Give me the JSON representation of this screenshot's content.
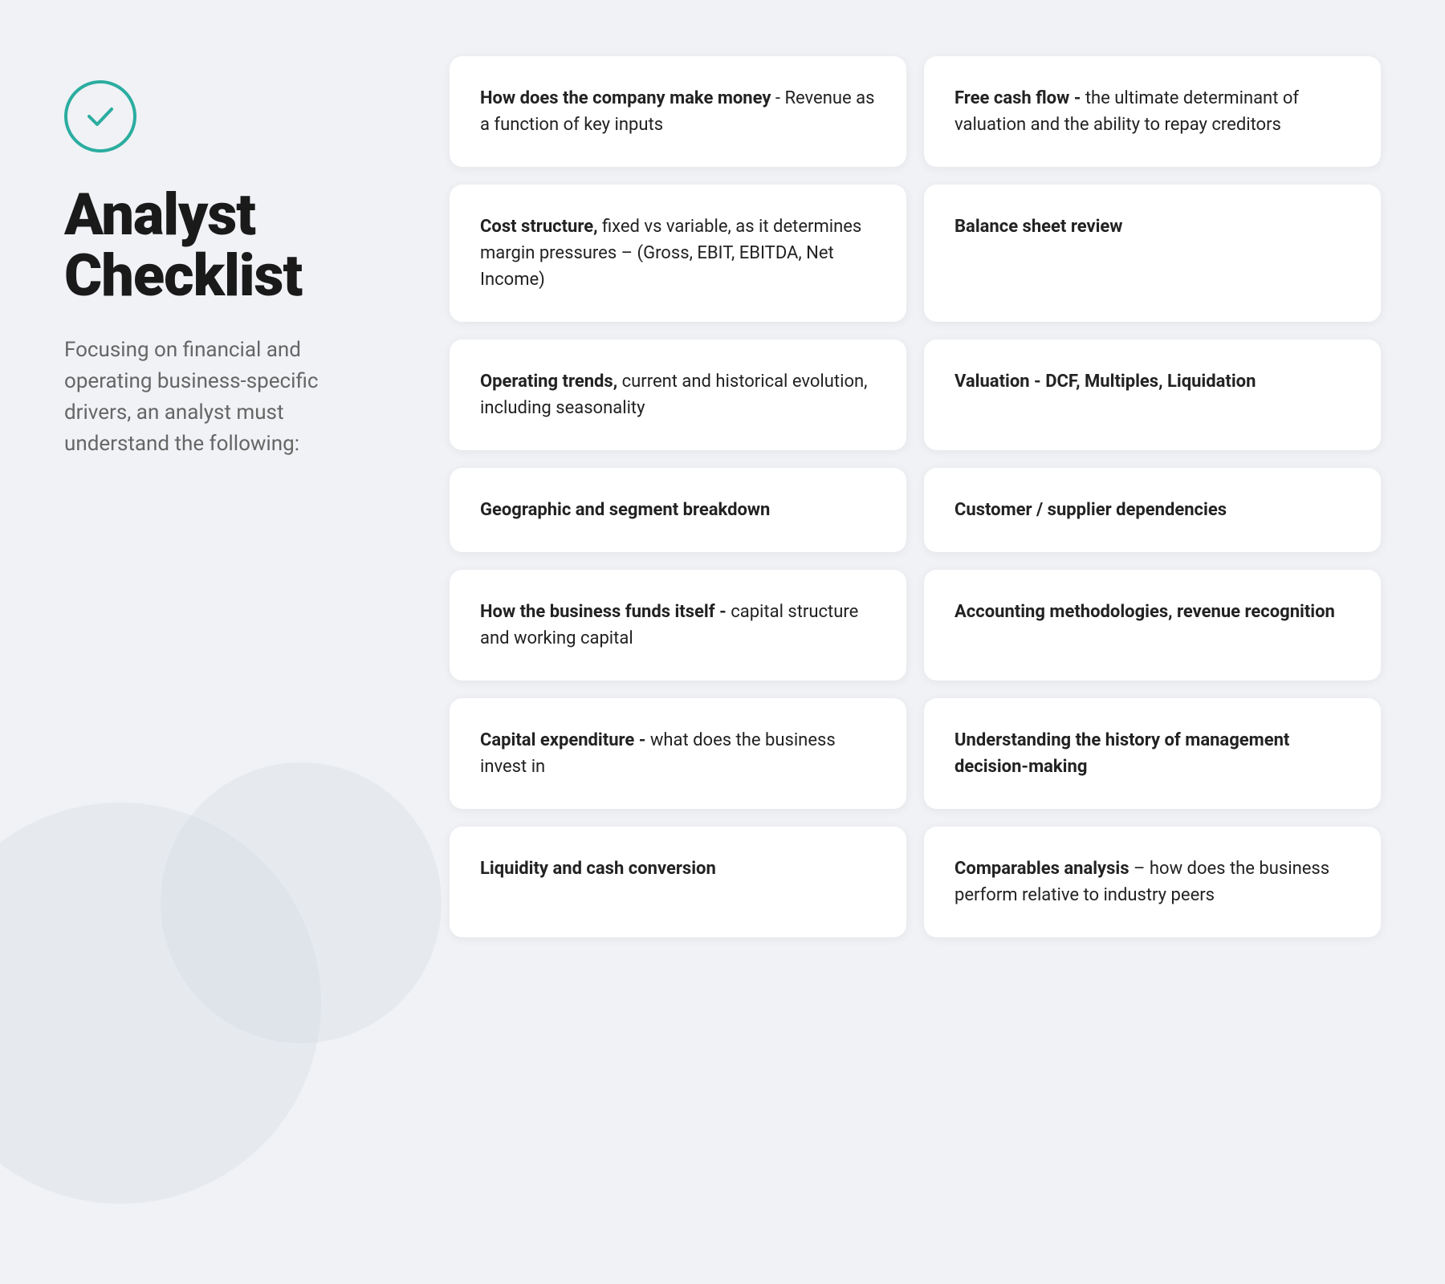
{
  "page": {
    "background_color": "#f0f2f5"
  },
  "left": {
    "check_icon_label": "checkmark",
    "title": "Analyst Checklist",
    "subtitle": "Focusing on financial and operating business-specific drivers, an analyst must understand the following:"
  },
  "cards": [
    {
      "id": "card-revenue",
      "html": "<strong>How does the company make money</strong> - Revenue as a function of key inputs"
    },
    {
      "id": "card-free-cash-flow",
      "html": "<strong>Free cash flow -</strong> the ultimate determinant of valuation and the ability to repay creditors"
    },
    {
      "id": "card-cost-structure",
      "html": "<strong>Cost structure,</strong> fixed vs variable, as it determines margin pressures – (Gross, EBIT, EBITDA, Net Income)"
    },
    {
      "id": "card-balance-sheet",
      "html": "<strong>Balance sheet review</strong>"
    },
    {
      "id": "card-operating-trends",
      "html": "<strong>Operating trends,</strong> current and historical evolution, including seasonality"
    },
    {
      "id": "card-valuation",
      "html": "<strong>Valuation - DCF, Multiples, Liquidation</strong>"
    },
    {
      "id": "card-geographic",
      "html": "<strong>Geographic and segment breakdown</strong>"
    },
    {
      "id": "card-customer-supplier",
      "html": "<strong>Customer / supplier dependencies</strong>"
    },
    {
      "id": "card-funds-itself",
      "html": "<strong>How the business funds itself -</strong> capital structure and working capital"
    },
    {
      "id": "card-accounting",
      "html": "<strong>Accounting methodologies, revenue recognition</strong>"
    },
    {
      "id": "card-capex",
      "html": "<strong>Capital expenditure -</strong> what does the business invest in"
    },
    {
      "id": "card-management",
      "html": "<strong>Understanding the history of management decision-making</strong>"
    },
    {
      "id": "card-liquidity",
      "html": "<strong>Liquidity and cash conversion</strong>"
    },
    {
      "id": "card-comparables",
      "html": "<strong>Comparables analysis</strong> – how does the business perform relative to industry peers"
    }
  ]
}
